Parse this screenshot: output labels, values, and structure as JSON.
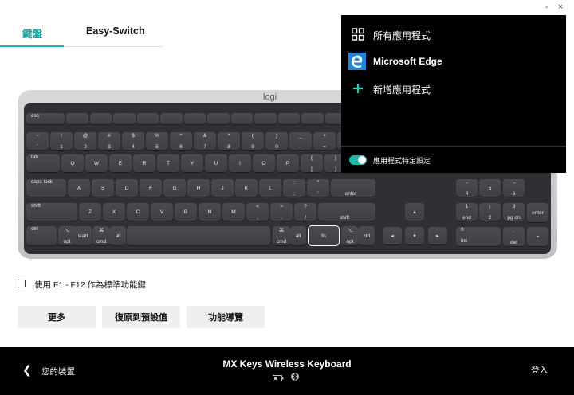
{
  "window": {
    "minimize": "-",
    "close": "×"
  },
  "tabs": [
    {
      "label": "鍵盤",
      "active": true
    },
    {
      "label": "Easy-Switch",
      "active": false
    }
  ],
  "keyboard": {
    "brand": "logi",
    "rows": [
      [
        "esc",
        "",
        "",
        "",
        "",
        "",
        "",
        "",
        "",
        "",
        "",
        "",
        "",
        ""
      ],
      [
        "~\n`",
        "!\n1",
        "@\n2",
        "#\n3",
        "$\n4",
        "%\n5",
        "^\n6",
        "&\n7",
        "*\n8",
        "(\n9",
        ")\n0",
        "_\n–",
        "+\n="
      ],
      [
        "tab",
        "Q",
        "W",
        "E",
        "R",
        "T",
        "Y",
        "U",
        "I",
        "O",
        "P",
        "{\n[",
        "}\n]"
      ],
      [
        "caps lock",
        "A",
        "S",
        "D",
        "F",
        "G",
        "H",
        "J",
        "K",
        "L",
        ":\n;",
        "\"\n'",
        "enter"
      ],
      [
        "shift",
        "Z",
        "X",
        "C",
        "V",
        "B",
        "N",
        "M",
        "<\n,",
        ">\n.",
        "?\n/",
        "shift"
      ],
      [
        "ctrl",
        "⌥\nopt",
        "start",
        "⌘\ncmd",
        "alt",
        "",
        "⌘\ncmd",
        "alt",
        "fn",
        "⌥\nopt",
        "ctrl"
      ]
    ],
    "nav": [
      "◂",
      "▴",
      "▾",
      "▸"
    ],
    "numpad": [
      [
        "←\n4",
        "5",
        "→\n6"
      ],
      [
        "1\nend",
        "↓\n2",
        "3\npg dn"
      ],
      [
        "0\nins",
        "·\ndel"
      ]
    ],
    "numpad_side": [
      "enter",
      "="
    ],
    "selected_key": "fn"
  },
  "app_menu": {
    "items": [
      {
        "icon": "grid-icon",
        "label": "所有應用程式"
      },
      {
        "icon": "edge-icon",
        "label": "Microsoft Edge"
      },
      {
        "icon": "plus-icon",
        "label": "新增應用程式"
      }
    ],
    "toggle_label": "應用程式特定設定",
    "toggle_on": true,
    "accent": "#20b5a9"
  },
  "fn_option": {
    "label": "使用 F1 - F12 作為標準功能鍵",
    "checked": false
  },
  "buttons": [
    {
      "label": "更多"
    },
    {
      "label": "復原到預設值"
    },
    {
      "label": "功能導覽"
    }
  ],
  "footer": {
    "back_label": "您的裝置",
    "device_name": "MX Keys Wireless Keyboard",
    "login": "登入"
  }
}
